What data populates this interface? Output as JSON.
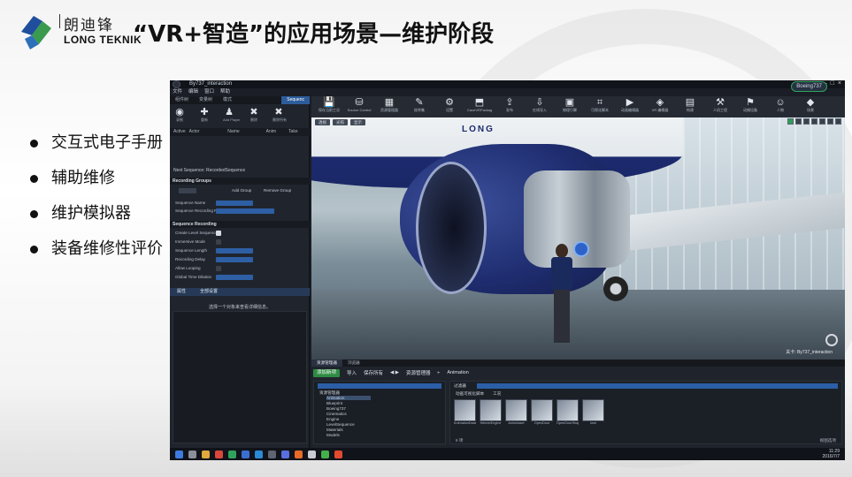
{
  "header": {
    "company_cn": "朗迪锋",
    "company_en": "LONG TEKNIK",
    "title": "“VR+智造”的应用场景—维护阶段"
  },
  "bullets": [
    "交互式电子手册",
    "辅助维修",
    "维护模拟器",
    "装备维修性评价"
  ],
  "colors": {
    "accent_blue": "#2e5fa4",
    "logo_blue": "#1f4f9c",
    "logo_green": "#3a9a4d"
  },
  "app": {
    "window_title": "By737_interaction",
    "menu": [
      "文件",
      "编辑",
      "窗口",
      "帮助"
    ],
    "project_badge": "Boeing737",
    "left_tabs": [
      "组件树",
      "变量树",
      "模式",
      "Sequenc"
    ],
    "left_tools": [
      {
        "icon": "record-icon",
        "glyph": "◉",
        "label": "录制"
      },
      {
        "icon": "add-icon",
        "glyph": "✚",
        "label": "重新"
      },
      {
        "icon": "add-player-icon",
        "glyph": "♟",
        "label": "Add Player"
      },
      {
        "icon": "delete-icon",
        "glyph": "✖",
        "label": "删除"
      },
      {
        "icon": "delete-all-icon",
        "glyph": "✖",
        "label": "删除所有"
      }
    ],
    "grid_headers": [
      "Active",
      "Actor",
      "Name",
      "Anim",
      "Take"
    ],
    "next_sequence": "Next Sequence: RecordedSequence",
    "recording_groups": {
      "title": "Recording Groups",
      "add_group": "Add Group",
      "remove_group": "Remove Group",
      "sequence_name_label": "Sequence Name",
      "sequence_recording_label": "Sequence Recording F"
    },
    "sequence_recording": {
      "title": "Sequence Recording",
      "rows": [
        "Create Level Sequence",
        "Immersive Mode",
        "Sequence Length",
        "Recording Delay",
        "Allow Looping",
        "Global Time Dilation"
      ]
    },
    "info_tabs": [
      "属性",
      "全部设置"
    ],
    "select_hint": "选择一个对象来查看详细信息。",
    "toolbar": [
      {
        "icon": "save-icon",
        "glyph": "💾",
        "label": "保存当前工况"
      },
      {
        "icon": "source-control-icon",
        "glyph": "⛁",
        "label": "Source Control"
      },
      {
        "icon": "content-icon",
        "glyph": "▦",
        "label": "资源管理器"
      },
      {
        "icon": "market-icon",
        "glyph": "✎",
        "label": "枚举集"
      },
      {
        "icon": "settings-icon",
        "glyph": "⚙",
        "label": "设置"
      },
      {
        "icon": "package-icon",
        "glyph": "⬒",
        "label": "CaveVRPackage"
      },
      {
        "icon": "publish-icon",
        "glyph": "⇪",
        "label": "发布"
      },
      {
        "icon": "import-icon",
        "glyph": "⇩",
        "label": "在线导入"
      },
      {
        "icon": "physics-icon",
        "glyph": "▣",
        "label": "物理引擎"
      },
      {
        "icon": "script-icon",
        "glyph": "⌗",
        "label": "可视化脚本"
      },
      {
        "icon": "animation-icon",
        "glyph": "▶",
        "label": "动画编辑器"
      },
      {
        "icon": "vr-editor-icon",
        "glyph": "◈",
        "label": "VR 编辑器"
      },
      {
        "icon": "build-icon",
        "glyph": "▤",
        "label": "构建"
      },
      {
        "icon": "ergonomics-icon",
        "glyph": "⚒",
        "label": "人机工程"
      },
      {
        "icon": "motion-icon",
        "glyph": "⚑",
        "label": "动捕设备"
      },
      {
        "icon": "person-icon",
        "glyph": "☺",
        "label": "人物"
      },
      {
        "icon": "cube-icon",
        "glyph": "◆",
        "label": "场景"
      }
    ],
    "viewport": {
      "chips": [
        "透视",
        "光照",
        "显示"
      ],
      "level_label": "关卡: By737_interaction",
      "fuselage_text": "LONG"
    },
    "content_browser": {
      "tabs": [
        "资源管理器",
        "浏览器"
      ],
      "add_new": "添加新项",
      "import": "导入",
      "save_all": "保存所有",
      "path": [
        "资源管理器",
        "Animation"
      ],
      "tree_root": "资源管理器",
      "tree_items": [
        "Animation",
        "Blueprint",
        "Boeing737",
        "Cinematics",
        "Engine",
        "LevelSequence",
        "Materials",
        "Models"
      ],
      "filter": "过滤器",
      "crumbs": [
        "动画可视化脚本",
        "工况"
      ],
      "assets": [
        "AnimationData",
        "HelmetEngine",
        "AnimAsset",
        "OpenDoor",
        "OpenDoorShape",
        "Iomi"
      ],
      "count": "6 项",
      "view_options": "视图选项"
    },
    "clock": {
      "time": "11:29",
      "date": "2016/7/7"
    }
  }
}
